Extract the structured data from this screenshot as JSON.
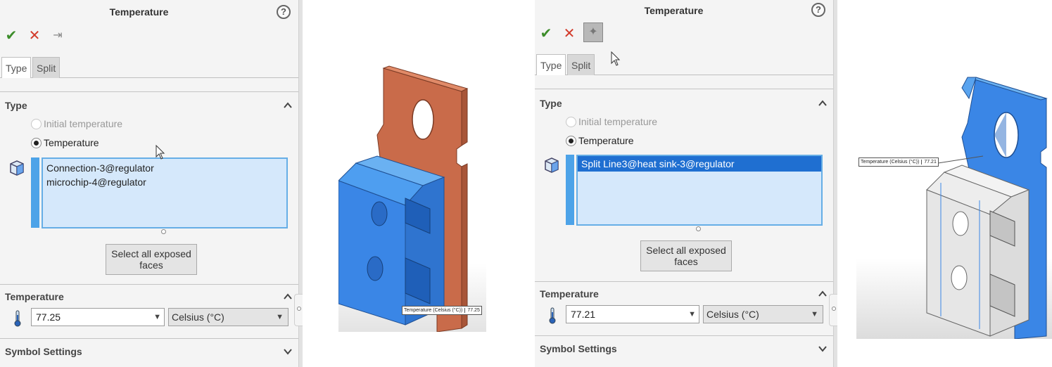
{
  "left_panel": {
    "title": "Temperature",
    "help_glyph": "?",
    "tabs": [
      {
        "label": "Type"
      },
      {
        "label": "Split"
      }
    ],
    "type_section": {
      "title": "Type",
      "radio_initial": "Initial temperature",
      "radio_temperature": "Temperature",
      "selected_option": "Temperature",
      "selection_items": [
        "Connection-3@regulator",
        "microchip-4@regulator"
      ]
    },
    "select_faces_button": "Select all exposed faces",
    "temperature_section": {
      "title": "Temperature",
      "value": "77.25",
      "unit": "Celsius (°C)"
    },
    "symbol_section": {
      "title": "Symbol Settings"
    }
  },
  "right_panel": {
    "title": "Temperature",
    "help_glyph": "?",
    "tabs": [
      {
        "label": "Type"
      },
      {
        "label": "Split"
      }
    ],
    "type_section": {
      "title": "Type",
      "radio_initial": "Initial temperature",
      "radio_temperature": "Temperature",
      "selected_option": "Temperature",
      "selection_items": [
        "Split Line3@heat sink-3@regulator"
      ]
    },
    "select_faces_button": "Select all exposed faces",
    "temperature_section": {
      "title": "Temperature",
      "value": "77.21",
      "unit": "Celsius (°C)"
    },
    "symbol_section": {
      "title": "Symbol Settings"
    }
  },
  "viewport_left": {
    "probe_label": "Temperature (Celsius (°C))",
    "probe_value": "77.25"
  },
  "viewport_right": {
    "probe_label": "Temperature (Celsius (°C))",
    "probe_value": "77.21"
  },
  "colors": {
    "accept": "#3d8d2b",
    "cancel": "#d23a2a",
    "selection_fill": "#d5e8fb",
    "selection_border": "#66aee6",
    "selected_highlight": "#1f6fd1",
    "model_blue": "#3a86e6",
    "model_copper": "#c96b4a",
    "model_grey": "#e6e6e6"
  },
  "icons": {
    "ok": "check-icon",
    "cancel": "close-icon",
    "pin": "pushpin-icon",
    "help": "help-icon",
    "collapse": "chevron-up-icon",
    "expand": "chevron-down-icon",
    "face": "face-selection-icon",
    "thermometer": "thermometer-icon"
  }
}
